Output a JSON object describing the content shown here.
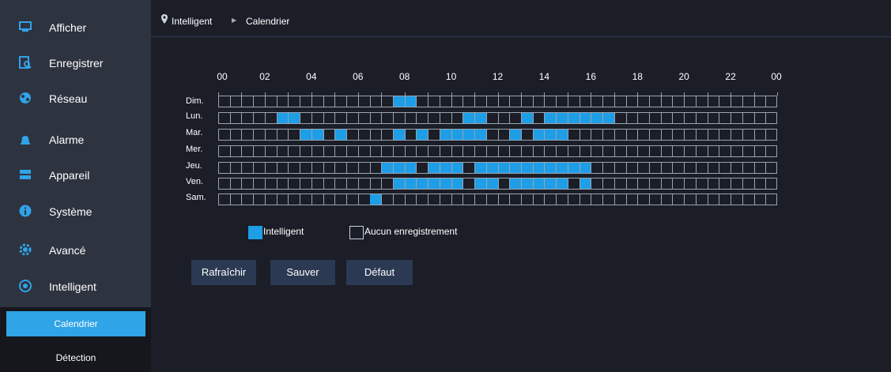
{
  "sidebar": {
    "items": [
      {
        "label": "Afficher",
        "icon": "monitor-icon"
      },
      {
        "label": "Enregistrer",
        "icon": "record-icon"
      },
      {
        "label": "Réseau",
        "icon": "network-icon"
      },
      {
        "label": "Alarme",
        "icon": "alarm-icon"
      },
      {
        "label": "Appareil",
        "icon": "device-icon"
      },
      {
        "label": "Système",
        "icon": "info-icon"
      },
      {
        "label": "Avancé",
        "icon": "gear-icon"
      },
      {
        "label": "Intelligent",
        "icon": "intelligent-icon"
      }
    ],
    "sub_items": [
      {
        "label": "Calendrier",
        "active": true
      },
      {
        "label": "Détection",
        "active": false
      }
    ]
  },
  "breadcrumb": {
    "root": "Intelligent",
    "current": "Calendrier"
  },
  "schedule": {
    "hours": [
      "00",
      "02",
      "04",
      "06",
      "08",
      "10",
      "12",
      "14",
      "16",
      "18",
      "20",
      "22",
      "00"
    ],
    "days": [
      {
        "label": "Dim.",
        "on": [
          15,
          16
        ]
      },
      {
        "label": "Lun.",
        "on": [
          5,
          6,
          21,
          22,
          26,
          28,
          29,
          30,
          31,
          32,
          33
        ]
      },
      {
        "label": "Mar.",
        "on": [
          7,
          8,
          10,
          15,
          17,
          19,
          20,
          21,
          22,
          25,
          27,
          28,
          29
        ]
      },
      {
        "label": "Mer.",
        "on": []
      },
      {
        "label": "Jeu.",
        "on": [
          14,
          15,
          16,
          18,
          19,
          20,
          22,
          23,
          24,
          25,
          26,
          27,
          28,
          29,
          30,
          31
        ]
      },
      {
        "label": "Ven.",
        "on": [
          15,
          16,
          17,
          18,
          19,
          20,
          22,
          23,
          25,
          26,
          27,
          28,
          29,
          31
        ]
      },
      {
        "label": "Sam.",
        "on": [
          13
        ]
      }
    ]
  },
  "legend": {
    "on_label": "Intelligent",
    "off_label": "Aucun enregistrement",
    "on_color": "#1e9ee6",
    "off_color": "#1b1e27"
  },
  "buttons": {
    "refresh": "Rafraîchir",
    "save": "Sauver",
    "default": "Défaut"
  }
}
